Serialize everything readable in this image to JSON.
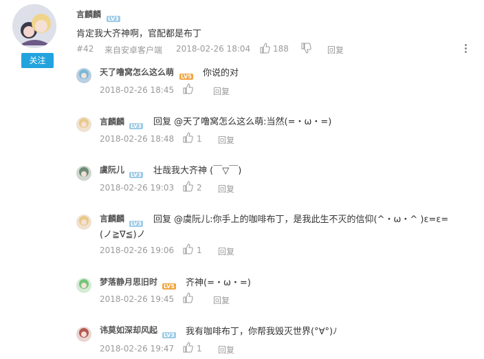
{
  "post": {
    "username": "言麟麟",
    "level": "LV3",
    "content": "肯定我大齐神啊，官配都是布丁",
    "floor": "#42",
    "source": "来自安卓客户端",
    "time": "2018-02-26 18:04",
    "likes": "188",
    "reply_label": "回复",
    "follow_label": "关注"
  },
  "replies": [
    {
      "username": "天了噜窝怎么这么萌",
      "level": "LV5",
      "level_color": "#f1a542",
      "content": "你说的对",
      "time": "2018-02-26 18:45",
      "likes": "",
      "reply_label": "回复"
    },
    {
      "username": "言麟麟",
      "level": "LV3",
      "level_color": "#9ccbe6",
      "content": "回复 @天了噜窝怎么这么萌:当然(=・ω・=)",
      "time": "2018-02-26 18:48",
      "likes": "1",
      "reply_label": "回复"
    },
    {
      "username": "虞阮儿",
      "level": "LV3",
      "level_color": "#9ccbe6",
      "content": "壮哉我大齐神 (￣▽￣)",
      "time": "2018-02-26 19:03",
      "likes": "2",
      "reply_label": "回复"
    },
    {
      "username": "言麟麟",
      "level": "LV3",
      "level_color": "#9ccbe6",
      "content_line1": "回复 @虞阮儿:你手上的咖啡布丁，是我此生不灭的信仰(^・ω・^ )ε=ε=",
      "content_line2": "(ノ≧∇≦)ノ",
      "time": "2018-02-26 19:06",
      "likes": "1",
      "reply_label": "回复"
    },
    {
      "username": "梦落静月思旧时",
      "level": "LV5",
      "level_color": "#f1a542",
      "content": "齐神(=・ω・=)",
      "time": "2018-02-26 19:45",
      "likes": "",
      "reply_label": "回复"
    },
    {
      "username": "讳莫如深却风起",
      "level": "LV3",
      "level_color": "#9ccbe6",
      "content": "我有咖啡布丁，你帮我毁灭世界(°∀°)ﾉ",
      "time": "2018-02-26 19:47",
      "likes": "1",
      "reply_label": "回复"
    }
  ]
}
